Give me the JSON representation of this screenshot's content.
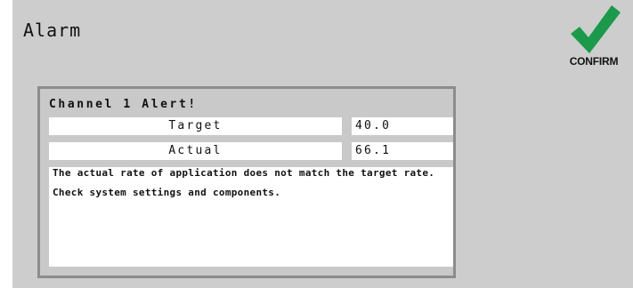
{
  "window": {
    "title": "Alarm"
  },
  "confirm": {
    "label": "CONFIRM",
    "icon": "checkmark-icon",
    "color": "#1a9a4a"
  },
  "alert": {
    "heading": "Channel 1 Alert!",
    "rows": [
      {
        "label": "Target",
        "value": "40.0"
      },
      {
        "label": "Actual",
        "value": "66.1"
      }
    ],
    "message": "The actual rate of application does not match the target rate.\n\nCheck system settings and components."
  }
}
